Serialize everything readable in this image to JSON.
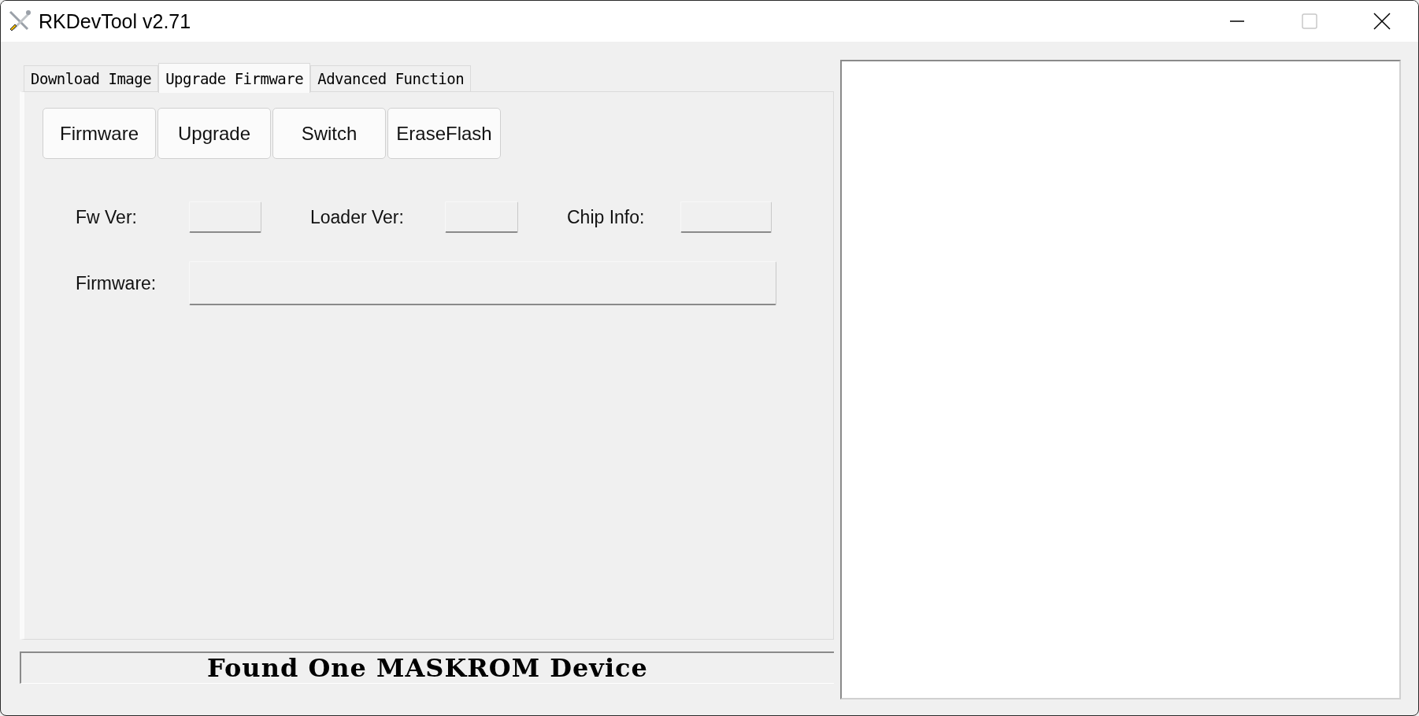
{
  "window": {
    "title": "RKDevTool v2.71"
  },
  "tabs": [
    {
      "label": "Download Image",
      "selected": false
    },
    {
      "label": "Upgrade Firmware",
      "selected": true
    },
    {
      "label": "Advanced Function",
      "selected": false
    }
  ],
  "buttons": [
    "Firmware",
    "Upgrade",
    "Switch",
    "EraseFlash"
  ],
  "info_fields": [
    {
      "label": "Fw Ver:"
    },
    {
      "label": "Loader Ver:"
    },
    {
      "label": "Chip Info:"
    }
  ],
  "firmware_field": {
    "label": "Firmware:"
  },
  "status_bar": "Found One MASKROM Device"
}
